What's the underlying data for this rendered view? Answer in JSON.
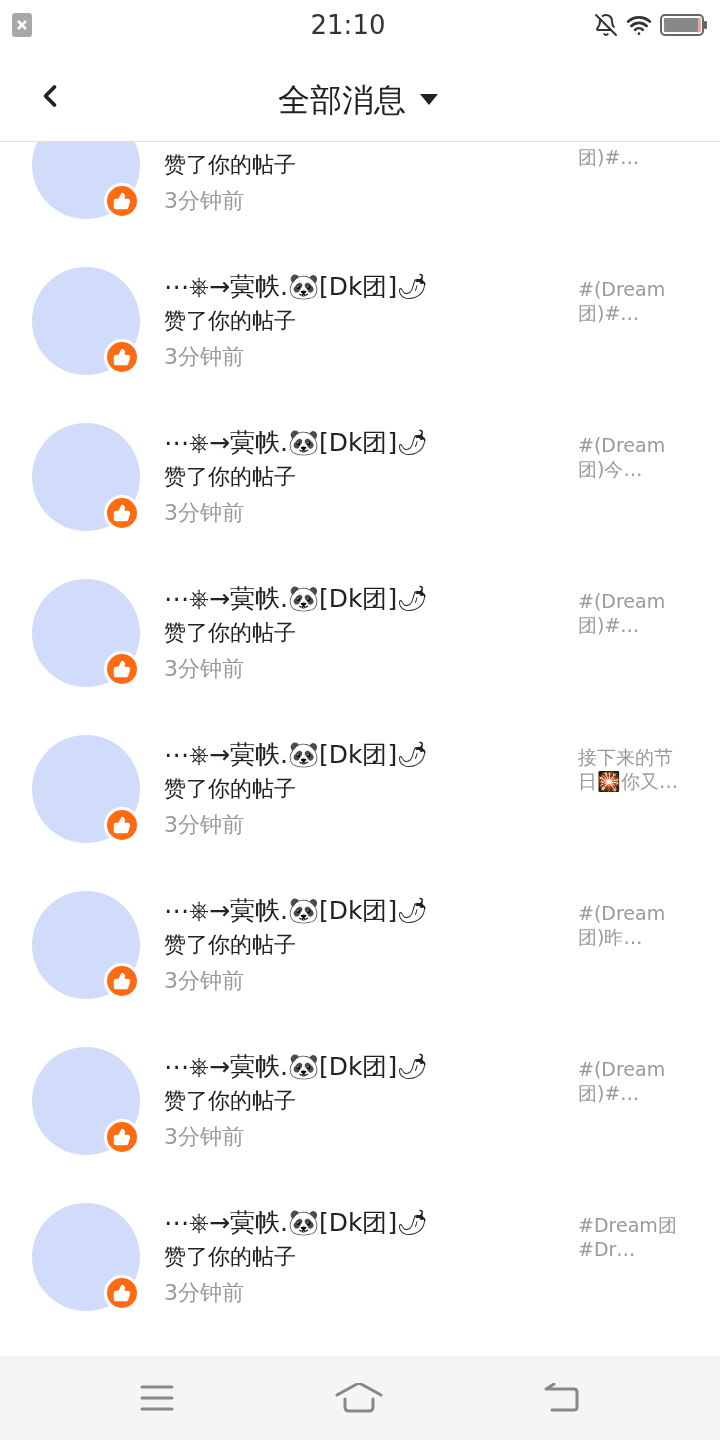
{
  "status_bar": {
    "time": "21:10"
  },
  "header": {
    "title": "全部消息"
  },
  "notifications": [
    {
      "action": "赞了你的帖子",
      "time": "3分钟前",
      "preview": "团)#…"
    },
    {
      "name": "⋯⎈→蓂帙.🐼[Dk团]🌶",
      "action": "赞了你的帖子",
      "time": "3分钟前",
      "preview": "#(Dream 团)#…"
    },
    {
      "name": "⋯⎈→蓂帙.🐼[Dk团]🌶",
      "action": "赞了你的帖子",
      "time": "3分钟前",
      "preview": "#(Dream 团)今…"
    },
    {
      "name": "⋯⎈→蓂帙.🐼[Dk团]🌶",
      "action": "赞了你的帖子",
      "time": "3分钟前",
      "preview": "#(Dream 团)#…"
    },
    {
      "name": "⋯⎈→蓂帙.🐼[Dk团]🌶",
      "action": "赞了你的帖子",
      "time": "3分钟前",
      "preview": "接下来的节日🎇你又…"
    },
    {
      "name": "⋯⎈→蓂帙.🐼[Dk团]🌶",
      "action": "赞了你的帖子",
      "time": "3分钟前",
      "preview": "#(Dream 团)昨…"
    },
    {
      "name": "⋯⎈→蓂帙.🐼[Dk团]🌶",
      "action": "赞了你的帖子",
      "time": "3分钟前",
      "preview": "#(Dream 团)#…"
    },
    {
      "name": "⋯⎈→蓂帙.🐼[Dk团]🌶",
      "action": "赞了你的帖子",
      "time": "3分钟前",
      "preview": "#Dream团 #Dr…"
    }
  ]
}
